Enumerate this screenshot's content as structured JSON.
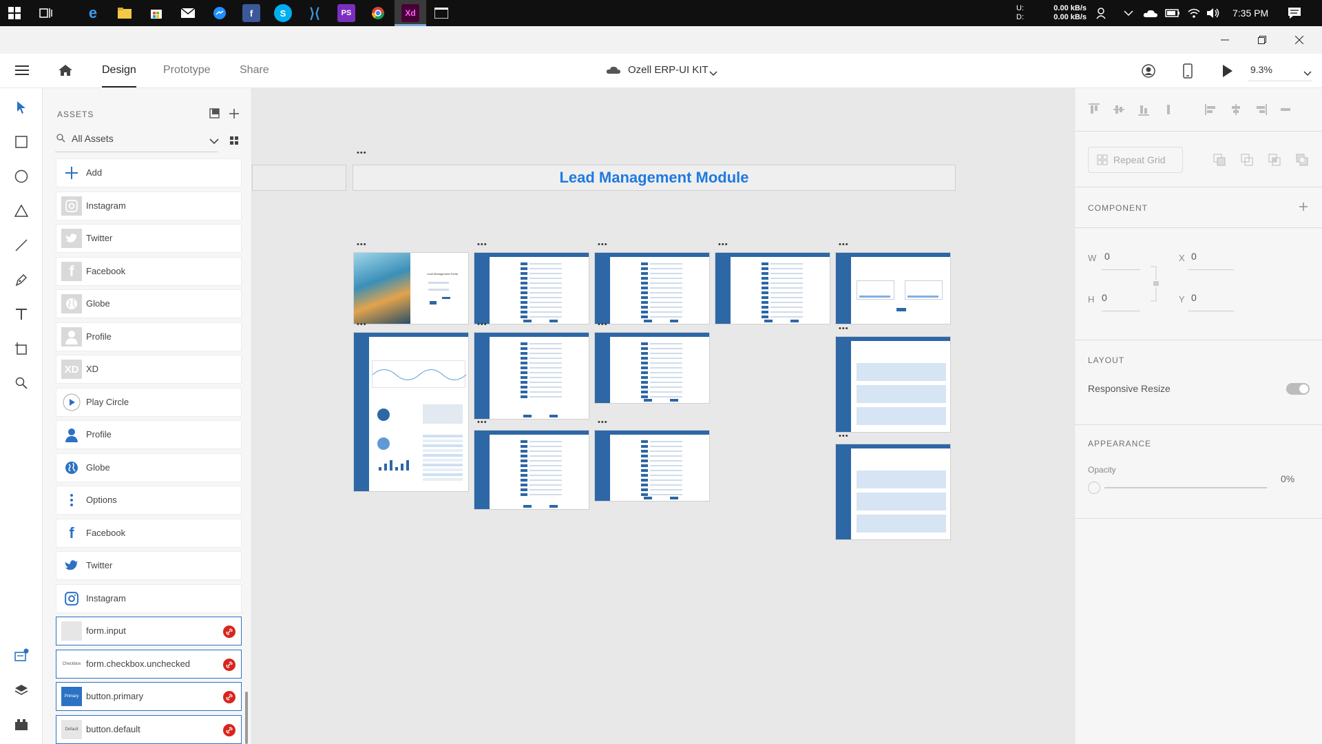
{
  "taskbar": {
    "net_label_up": "U:",
    "net_label_down": "D:",
    "net_up": "0.00 kB/s",
    "net_down": "0.00 kB/s",
    "time": "7:35 PM",
    "apps": [
      "windows-start",
      "task-view",
      "edge",
      "file-explorer",
      "store",
      "mail",
      "messenger",
      "facebook",
      "skype",
      "vscode",
      "phpstorm",
      "chrome",
      "adobe-xd",
      "terminal"
    ]
  },
  "app": {
    "tabs": [
      "Design",
      "Prototype",
      "Share"
    ],
    "active_tab": "Design",
    "doc_title": "Ozell ERP-UI KIT",
    "zoom": "9.3%"
  },
  "assets": {
    "header": "ASSETS",
    "filter": "All Assets",
    "items": [
      {
        "label": "Add",
        "icon": "plus-icon"
      },
      {
        "label": "Instagram",
        "icon": "instagram-icon"
      },
      {
        "label": "Twitter",
        "icon": "twitter-icon"
      },
      {
        "label": "Facebook",
        "icon": "facebook-icon"
      },
      {
        "label": "Globe",
        "icon": "globe-icon"
      },
      {
        "label": "Profile",
        "icon": "profile-icon"
      },
      {
        "label": "XD",
        "icon": "xd-icon"
      },
      {
        "label": "Play Circle",
        "icon": "play-circle-icon"
      },
      {
        "label": "Profile",
        "icon": "profile-icon"
      },
      {
        "label": "Globe",
        "icon": "globe-icon"
      },
      {
        "label": "Options",
        "icon": "options-icon"
      },
      {
        "label": "Facebook",
        "icon": "facebook-icon"
      },
      {
        "label": "Twitter",
        "icon": "twitter-icon"
      },
      {
        "label": "Instagram",
        "icon": "instagram-icon"
      }
    ],
    "components": [
      {
        "label": "form.input",
        "thumb": ""
      },
      {
        "label": "form.checkbox.unchecked",
        "thumb": "Checkbox"
      },
      {
        "label": "button.primary",
        "thumb": "Primary"
      },
      {
        "label": "button.default",
        "thumb": "Default"
      }
    ]
  },
  "canvas": {
    "module_title": "Lead Management Module",
    "thumb_login_title": "Lead Management Portal"
  },
  "props": {
    "repeat_grid": "Repeat Grid",
    "component_title": "COMPONENT",
    "w_label": "W",
    "w_value": "0",
    "h_label": "H",
    "h_value": "0",
    "x_label": "X",
    "x_value": "0",
    "y_label": "Y",
    "y_value": "0",
    "layout_title": "LAYOUT",
    "responsive_resize": "Responsive Resize",
    "appearance_title": "APPEARANCE",
    "opacity_label": "Opacity",
    "opacity_value": "0%"
  },
  "colors": {
    "accent": "#2b72c4",
    "artboard_blue": "#2d67a6",
    "title_blue": "#1f7ae0",
    "link_badge": "#d9251c"
  }
}
